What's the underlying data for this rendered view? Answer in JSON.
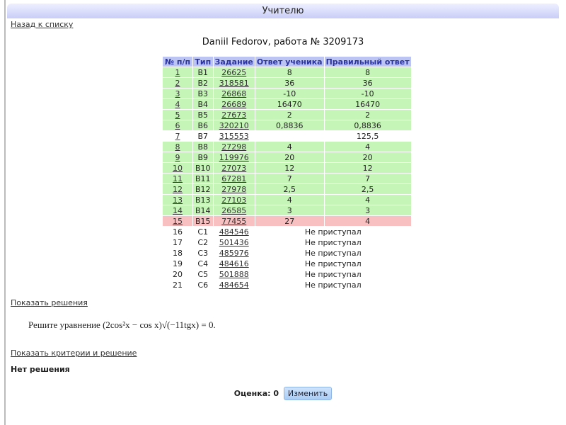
{
  "header": {
    "title": "Учителю"
  },
  "back_link": "Назад к списку",
  "work_title": "Daniil Fedorov, работа № 3209173",
  "table": {
    "columns": [
      "№ п/п",
      "Тип",
      "Задание",
      "Ответ ученика",
      "Правильный ответ"
    ],
    "rows": [
      {
        "n": "1",
        "type": "B1",
        "task": "26625",
        "answer": "8",
        "correct": "8",
        "status": "ok"
      },
      {
        "n": "2",
        "type": "B2",
        "task": "318581",
        "answer": "36",
        "correct": "36",
        "status": "ok"
      },
      {
        "n": "3",
        "type": "B3",
        "task": "26868",
        "answer": "-10",
        "correct": "-10",
        "status": "ok"
      },
      {
        "n": "4",
        "type": "B4",
        "task": "26689",
        "answer": "16470",
        "correct": "16470",
        "status": "ok"
      },
      {
        "n": "5",
        "type": "B5",
        "task": "27673",
        "answer": "2",
        "correct": "2",
        "status": "ok"
      },
      {
        "n": "6",
        "type": "B6",
        "task": "320210",
        "answer": "0,8836",
        "correct": "0,8836",
        "status": "ok"
      },
      {
        "n": "7",
        "type": "B7",
        "task": "315553",
        "answer": "",
        "correct": "125,5",
        "status": "none"
      },
      {
        "n": "8",
        "type": "B8",
        "task": "27298",
        "answer": "4",
        "correct": "4",
        "status": "ok"
      },
      {
        "n": "9",
        "type": "B9",
        "task": "119976",
        "answer": "20",
        "correct": "20",
        "status": "ok"
      },
      {
        "n": "10",
        "type": "B10",
        "task": "27073",
        "answer": "12",
        "correct": "12",
        "status": "ok"
      },
      {
        "n": "11",
        "type": "B11",
        "task": "67281",
        "answer": "7",
        "correct": "7",
        "status": "ok"
      },
      {
        "n": "12",
        "type": "B12",
        "task": "27978",
        "answer": "2,5",
        "correct": "2,5",
        "status": "ok"
      },
      {
        "n": "13",
        "type": "B13",
        "task": "27103",
        "answer": "4",
        "correct": "4",
        "status": "ok"
      },
      {
        "n": "14",
        "type": "B14",
        "task": "26585",
        "answer": "3",
        "correct": "3",
        "status": "ok"
      },
      {
        "n": "15",
        "type": "B15",
        "task": "77455",
        "answer": "27",
        "correct": "4",
        "status": "bad"
      },
      {
        "n": "16",
        "type": "C1",
        "task": "484546",
        "note": "Не приступал"
      },
      {
        "n": "17",
        "type": "C2",
        "task": "501436",
        "note": "Не приступал"
      },
      {
        "n": "18",
        "type": "C3",
        "task": "485976",
        "note": "Не приступал"
      },
      {
        "n": "19",
        "type": "C4",
        "task": "484616",
        "note": "Не приступал"
      },
      {
        "n": "20",
        "type": "C5",
        "task": "501888",
        "note": "Не приступал"
      },
      {
        "n": "21",
        "type": "C6",
        "task": "484654",
        "note": "Не приступал"
      }
    ]
  },
  "show_solutions": "Показать решения",
  "task_text": "Решите уравнение (2cos²x − cos x)√(−11tgx) = 0.",
  "show_criteria": "Показать критерии и решение",
  "no_solution": "Нет решения",
  "grade": {
    "label": "Оценка: 0",
    "button": "Изменить"
  }
}
